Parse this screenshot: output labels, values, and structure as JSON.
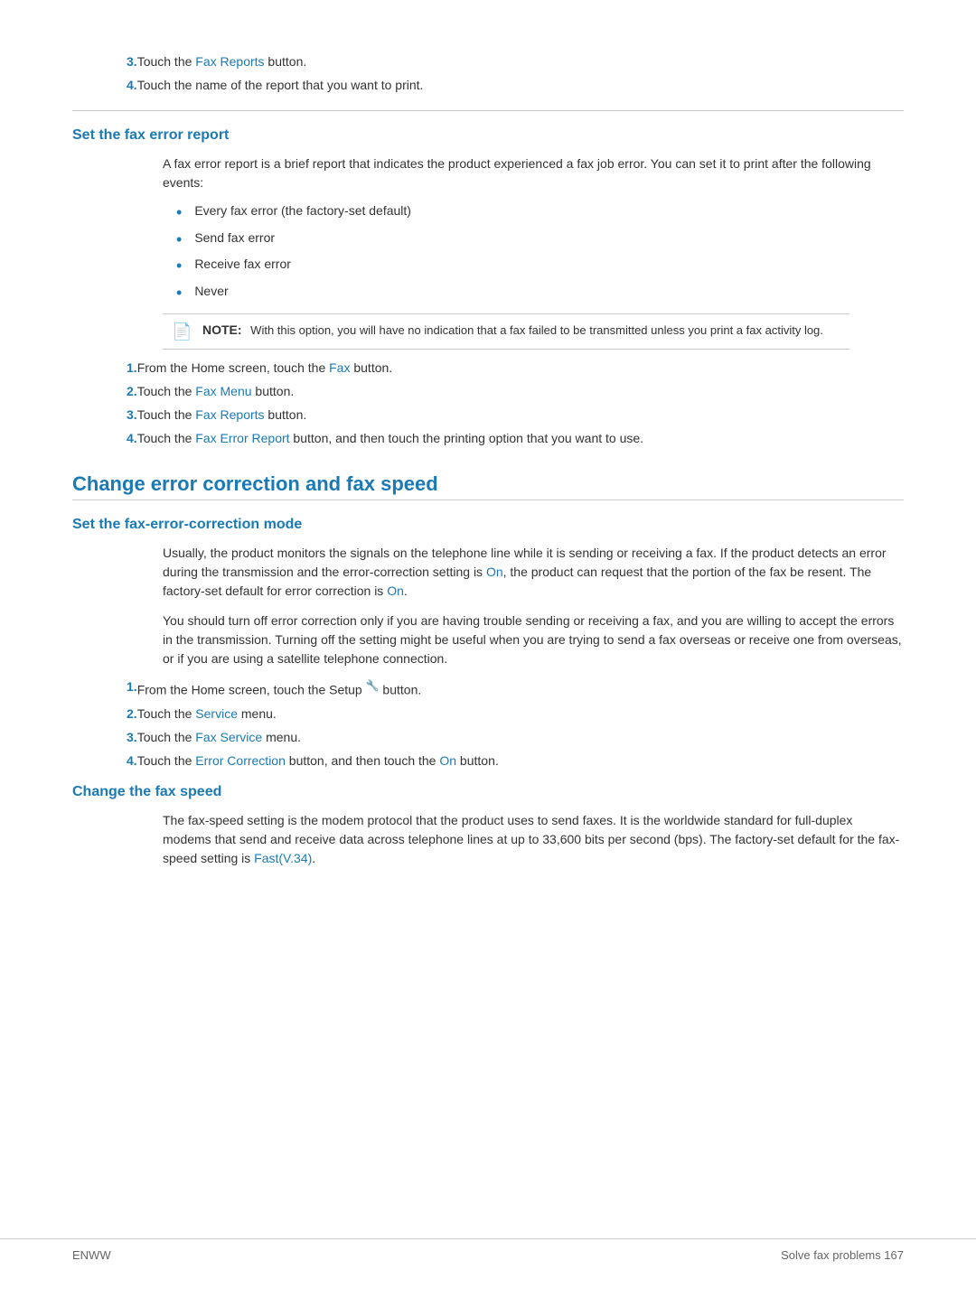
{
  "page": {
    "intro_items": [
      {
        "num": "3.",
        "text_before": "Touch the ",
        "link_text": "Fax Reports",
        "text_after": " button."
      },
      {
        "num": "4.",
        "text": "Touch the name of the report that you want to print."
      }
    ],
    "section1": {
      "heading": "Set the fax error report",
      "body": "A fax error report is a brief report that indicates the product experienced a fax job error. You can set it to print after the following events:",
      "bullets": [
        "Every fax error (the factory-set default)",
        "Send fax error",
        "Receive fax error",
        "Never"
      ],
      "note": {
        "label": "NOTE:",
        "text": "With this option, you will have no indication that a fax failed to be transmitted unless you print a fax activity log."
      },
      "steps": [
        {
          "num": "1.",
          "text_before": "From the Home screen, touch the ",
          "link_text": "Fax",
          "text_after": " button."
        },
        {
          "num": "2.",
          "text_before": "Touch the ",
          "link_text": "Fax Menu",
          "text_after": " button."
        },
        {
          "num": "3.",
          "text_before": "Touch the ",
          "link_text": "Fax Reports",
          "text_after": " button."
        },
        {
          "num": "4.",
          "text_before": "Touch the ",
          "link_text": "Fax Error Report",
          "text_after": " button, and then touch the printing option that you want to use."
        }
      ]
    },
    "section2": {
      "heading": "Change error correction and fax speed",
      "subsection1": {
        "heading": "Set the fax-error-correction mode",
        "body1": "Usually, the product monitors the signals on the telephone line while it is sending or receiving a fax. If the product detects an error during the transmission and the error-correction setting is On, the product can request that the portion of the fax be resent. The factory-set default for error correction is On.",
        "body1_links": [
          "On",
          "On"
        ],
        "body2": "You should turn off error correction only if you are having trouble sending or receiving a fax, and you are willing to accept the errors in the transmission. Turning off the setting might be useful when you are trying to send a fax overseas or receive one from overseas, or if you are using a satellite telephone connection.",
        "steps": [
          {
            "num": "1.",
            "text": "From the Home screen, touch the Setup",
            "icon": "⚙",
            "text_after": " button."
          },
          {
            "num": "2.",
            "text_before": "Touch the ",
            "link_text": "Service",
            "text_after": " menu."
          },
          {
            "num": "3.",
            "text_before": "Touch the ",
            "link_text": "Fax Service",
            "text_after": " menu."
          },
          {
            "num": "4.",
            "text_before": "Touch the ",
            "link_text": "Error Correction",
            "text_after": " button, and then touch the ",
            "link_text2": "On",
            "text_after2": " button."
          }
        ]
      },
      "subsection2": {
        "heading": "Change the fax speed",
        "body": "The fax-speed setting is the modem protocol that the product uses to send faxes. It is the worldwide standard for full-duplex modems that send and receive data across telephone lines at up to 33,600 bits per second (bps). The factory-set default for the fax-speed setting is Fast(V.34).",
        "body_link": "Fast(V.34)"
      }
    }
  },
  "footer": {
    "left": "ENWW",
    "right": "Solve fax problems   167"
  },
  "colors": {
    "blue": "#1a7ab5",
    "text": "#333333",
    "light_gray": "#999999"
  }
}
